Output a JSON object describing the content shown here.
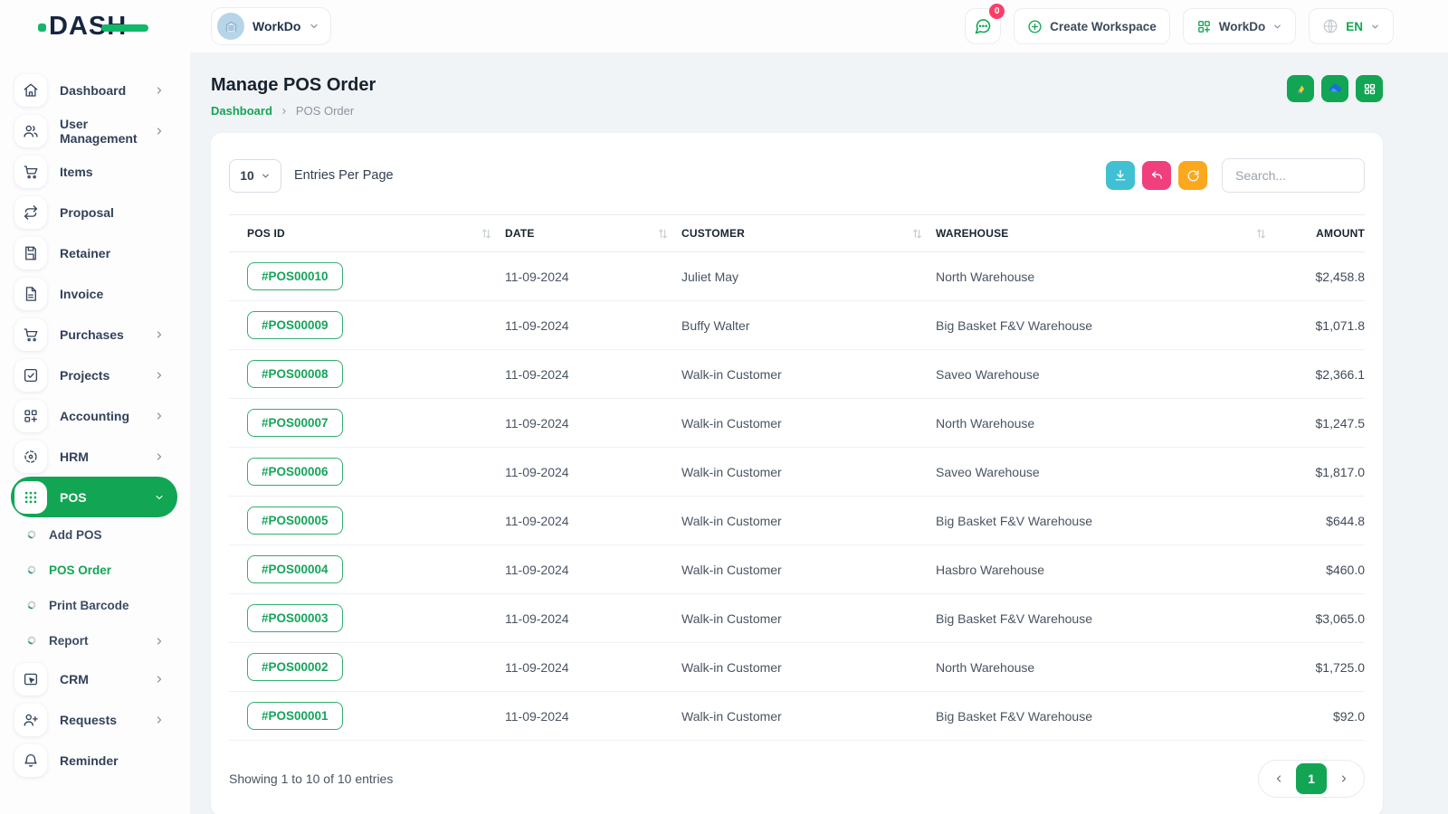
{
  "brand": {
    "name": "DASH"
  },
  "topbar": {
    "workspace_selector": {
      "label": "WorkDo"
    },
    "messages": {
      "badge": "0"
    },
    "create_workspace": {
      "label": "Create Workspace"
    },
    "workspace_menu": {
      "label": "WorkDo"
    },
    "language": {
      "label": "EN"
    }
  },
  "sidebar": {
    "items": [
      {
        "label": "Dashboard",
        "icon": "home-icon",
        "chevron": true
      },
      {
        "label": "User Management",
        "icon": "users-icon",
        "chevron": true
      },
      {
        "label": "Items",
        "icon": "items-cart-icon",
        "chevron": false
      },
      {
        "label": "Proposal",
        "icon": "proposal-icon",
        "chevron": false
      },
      {
        "label": "Retainer",
        "icon": "retainer-icon",
        "chevron": false
      },
      {
        "label": "Invoice",
        "icon": "invoice-icon",
        "chevron": false
      },
      {
        "label": "Purchases",
        "icon": "purchases-cart-icon",
        "chevron": true
      },
      {
        "label": "Projects",
        "icon": "projects-icon",
        "chevron": true
      },
      {
        "label": "Accounting",
        "icon": "accounting-icon",
        "chevron": true
      },
      {
        "label": "HRM",
        "icon": "hrm-icon",
        "chevron": true
      },
      {
        "label": "POS",
        "icon": "pos-grid-icon",
        "chevron": true,
        "active": true,
        "expanded": true,
        "children": [
          {
            "label": "Add POS",
            "active": false,
            "chevron": false
          },
          {
            "label": "POS Order",
            "active": true,
            "chevron": false
          },
          {
            "label": "Print Barcode",
            "active": false,
            "chevron": false
          },
          {
            "label": "Report",
            "active": false,
            "chevron": true
          }
        ]
      },
      {
        "label": "CRM",
        "icon": "crm-icon",
        "chevron": true
      },
      {
        "label": "Requests",
        "icon": "user-plus-icon",
        "chevron": true
      },
      {
        "label": "Reminder",
        "icon": "bell-icon",
        "chevron": false
      }
    ]
  },
  "page": {
    "title": "Manage POS Order",
    "breadcrumb": [
      "Dashboard",
      "POS Order"
    ],
    "quick_actions": [
      "google-drive-icon",
      "onedrive-icon",
      "grid-icon"
    ]
  },
  "table_card": {
    "entries_per_page": {
      "value": "10",
      "label": "Entries Per Page"
    },
    "search": {
      "placeholder": "Search..."
    },
    "columns": [
      "POS ID",
      "DATE",
      "CUSTOMER",
      "WAREHOUSE",
      "AMOUNT"
    ],
    "rows": [
      {
        "pos_id": "#POS00010",
        "date": "11-09-2024",
        "customer": "Juliet May",
        "warehouse": "North Warehouse",
        "amount": "$2,458.8"
      },
      {
        "pos_id": "#POS00009",
        "date": "11-09-2024",
        "customer": "Buffy Walter",
        "warehouse": "Big Basket F&V Warehouse",
        "amount": "$1,071.8"
      },
      {
        "pos_id": "#POS00008",
        "date": "11-09-2024",
        "customer": "Walk-in Customer",
        "warehouse": "Saveo Warehouse",
        "amount": "$2,366.1"
      },
      {
        "pos_id": "#POS00007",
        "date": "11-09-2024",
        "customer": "Walk-in Customer",
        "warehouse": "North Warehouse",
        "amount": "$1,247.5"
      },
      {
        "pos_id": "#POS00006",
        "date": "11-09-2024",
        "customer": "Walk-in Customer",
        "warehouse": "Saveo Warehouse",
        "amount": "$1,817.0"
      },
      {
        "pos_id": "#POS00005",
        "date": "11-09-2024",
        "customer": "Walk-in Customer",
        "warehouse": "Big Basket F&V Warehouse",
        "amount": "$644.8"
      },
      {
        "pos_id": "#POS00004",
        "date": "11-09-2024",
        "customer": "Walk-in Customer",
        "warehouse": "Hasbro Warehouse",
        "amount": "$460.0"
      },
      {
        "pos_id": "#POS00003",
        "date": "11-09-2024",
        "customer": "Walk-in Customer",
        "warehouse": "Big Basket F&V Warehouse",
        "amount": "$3,065.0"
      },
      {
        "pos_id": "#POS00002",
        "date": "11-09-2024",
        "customer": "Walk-in Customer",
        "warehouse": "North Warehouse",
        "amount": "$1,725.0"
      },
      {
        "pos_id": "#POS00001",
        "date": "11-09-2024",
        "customer": "Walk-in Customer",
        "warehouse": "Big Basket F&V Warehouse",
        "amount": "$92.0"
      }
    ],
    "footer": {
      "showing": "Showing 1 to 10 of 10 entries",
      "page": "1"
    }
  },
  "colors": {
    "primary_green": "#12a554",
    "teal_button": "#41c0d3",
    "pink_button": "#f13f7d",
    "orange_button": "#fba81f",
    "badge_red": "#fb3e68",
    "drive_yellow": "#fdc731",
    "onedrive_blue": "#1a6fd4"
  }
}
